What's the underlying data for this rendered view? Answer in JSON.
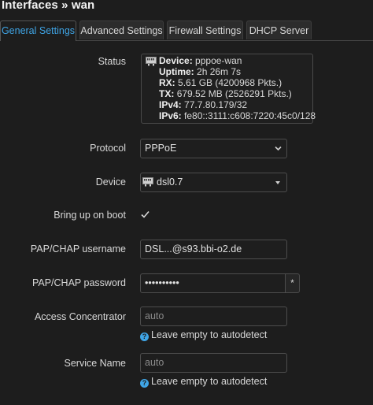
{
  "header": {
    "title": "Interfaces » wan"
  },
  "tabs": [
    {
      "label": "General Settings"
    },
    {
      "label": "Advanced Settings"
    },
    {
      "label": "Firewall Settings"
    },
    {
      "label": "DHCP Server"
    }
  ],
  "status": {
    "label": "Status",
    "device_key": "Device:",
    "device_val": "pppoe-wan",
    "uptime_key": "Uptime:",
    "uptime_val": "2h 26m 7s",
    "rx_key": "RX:",
    "rx_val": "5.61 GB (4200968 Pkts.)",
    "tx_key": "TX:",
    "tx_val": "679.52 MB (2526291 Pkts.)",
    "ipv4_key": "IPv4:",
    "ipv4_val": "77.7.80.179/32",
    "ipv6_key": "IPv6:",
    "ipv6_val": "fe80::3111:c608:7220:45c0/128"
  },
  "protocol": {
    "label": "Protocol",
    "value": "PPPoE"
  },
  "device": {
    "label": "Device",
    "value": "dsl0.7"
  },
  "bring_up": {
    "label": "Bring up on boot",
    "checked": true
  },
  "username": {
    "label": "PAP/CHAP username",
    "value": "DSL...@s93.bbi-o2.de"
  },
  "password": {
    "label": "PAP/CHAP password",
    "value": "••••••••••",
    "toggle": "*"
  },
  "access_concentrator": {
    "label": "Access Concentrator",
    "placeholder": "auto",
    "hint": "Leave empty to autodetect"
  },
  "service_name": {
    "label": "Service Name",
    "placeholder": "auto",
    "hint": "Leave empty to autodetect"
  },
  "colors": {
    "accent": "#3fa5e6",
    "background": "#1d1d1d"
  }
}
